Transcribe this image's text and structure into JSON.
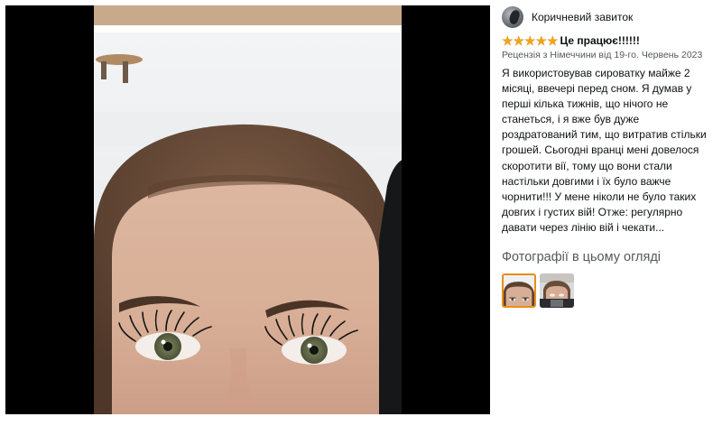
{
  "photo_viewer": {
    "image_alt": ""
  },
  "review": {
    "author": "Коричневий завиток",
    "avatar_icon": "user-avatar-icon",
    "rating": 5,
    "rating_max": 5,
    "star_color": "#f4a41c",
    "title": "Це працює!!!!!!",
    "meta": "Рецензія з Німеччини від 19-го. Червень 2023",
    "body": "Я використовував сироватку майже 2 місяці, ввечері перед сном. Я думав у перші кілька тижнів, що нічого не станеться, і я вже був дуже роздратований тим, що витратив стільки грошей. Сьогодні вранці мені довелося скоротити вії, тому що вони стали настільки довгими і їх було важче чорнити!!! У мене ніколи не було таких довгих і густих вій! Отже: регулярно давати через лінію вій і чекати..."
  },
  "photos_section": {
    "heading": "Фотографії в цьому огляді",
    "thumbnails": [
      {
        "selected": true
      },
      {
        "selected": false
      }
    ],
    "selected_border_color": "#e88e19"
  }
}
